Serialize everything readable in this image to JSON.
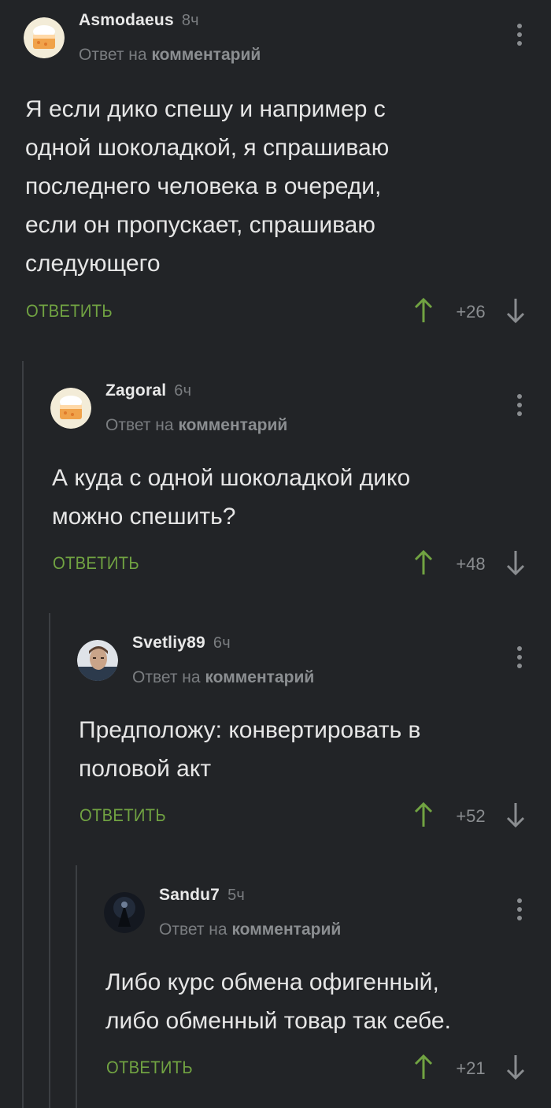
{
  "reply_label": "ОТВЕТИТЬ",
  "reply_prefix": "Ответ на",
  "reply_target": "комментарий",
  "colors": {
    "background": "#222427",
    "accent_green": "#71a342",
    "muted": "#7a7d80"
  },
  "comments": [
    {
      "username": "Asmodaeus",
      "time": "8ч",
      "avatar": "default-cake-avatar",
      "text": "Я если дико спешу и например с\nодной шоколадкой, я спрашиваю\nпоследнего человека в очереди,\nесли он пропускает, спрашиваю\nследующего",
      "votes": "+26"
    },
    {
      "username": "Zagoral",
      "time": "6ч",
      "avatar": "default-cake-avatar",
      "text": "А куда с одной шоколадкой дико\nможно спешить?",
      "votes": "+48"
    },
    {
      "username": "Svetliy89",
      "time": "6ч",
      "avatar": "photo-avatar",
      "text": "Предположу: конвертировать в\nполовой акт",
      "votes": "+52"
    },
    {
      "username": "Sandu7",
      "time": "5ч",
      "avatar": "dark-photo-avatar",
      "text": "Либо курс обмена офигенный,\nлибо обменный товар так себе.",
      "votes": "+21"
    }
  ]
}
